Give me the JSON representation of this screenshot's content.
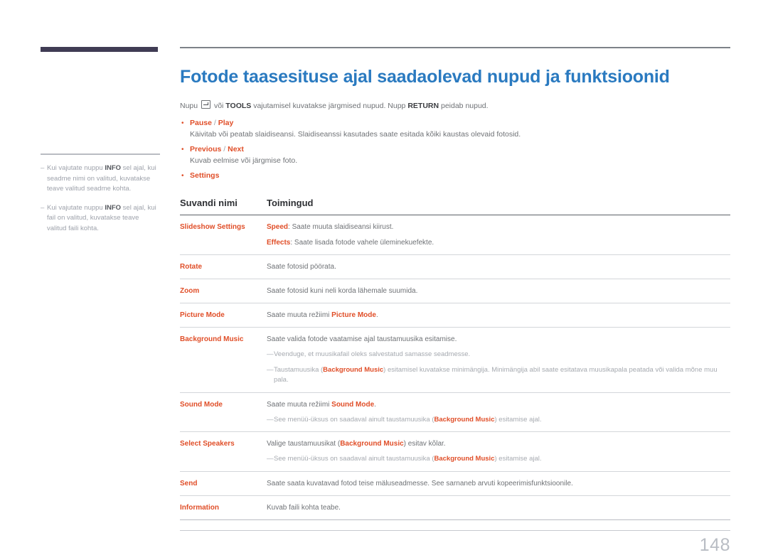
{
  "sidebar": {
    "notes": [
      {
        "dash": "–",
        "pre": "Kui vajutate nuppu ",
        "bold": "INFO",
        "post": " sel ajal, kui seadme nimi on valitud, kuvatakse teave valitud seadme kohta."
      },
      {
        "dash": "–",
        "pre": "Kui vajutate nuppu ",
        "bold": "INFO",
        "post": " sel ajal, kui fail on valitud, kuvatakse teave valitud faili kohta."
      }
    ]
  },
  "content": {
    "title": "Fotode taasesituse ajal saadaolevad nupud ja funktsioonid",
    "intro": {
      "p1": "Nupu ",
      "icon": "enter-key-icon",
      "p2": " või ",
      "b1": "TOOLS",
      "p3": " vajutamisel kuvatakse järgmised nupud. Nupp ",
      "b2": "RETURN",
      "p4": " peidab nupud."
    },
    "bullets": [
      {
        "dot": "•",
        "title_a": "Pause",
        "sep": " / ",
        "title_b": "Play",
        "desc": "Käivitab või peatab slaidiseansi. Slaidiseanssi kasutades saate esitada kõiki kaustas olevaid fotosid."
      },
      {
        "dot": "•",
        "title_a": "Previous",
        "sep": " / ",
        "title_b": "Next",
        "desc": "Kuvab eelmise või järgmise foto."
      },
      {
        "dot": "•",
        "title_a": "Settings",
        "sep": "",
        "title_b": "",
        "desc": ""
      }
    ],
    "table": {
      "headers": {
        "col1": "Suvandi nimi",
        "col2": "Toimingud"
      },
      "rows": [
        {
          "name": "Slideshow Settings",
          "lines": [
            {
              "hl": "Speed",
              "text": ": Saate muuta slaidiseansi kiirust."
            },
            {
              "hl": "Effects",
              "text": ": Saate lisada fotode vahele üleminekuefekte."
            }
          ],
          "subs": []
        },
        {
          "name": "Rotate",
          "lines": [
            {
              "hl": "",
              "text": "Saate fotosid pöörata."
            }
          ],
          "subs": []
        },
        {
          "name": "Zoom",
          "lines": [
            {
              "hl": "",
              "text": "Saate fotosid kuni neli korda lähemale suumida."
            }
          ],
          "subs": []
        },
        {
          "name": "Picture Mode",
          "lines": [
            {
              "hl": "",
              "text": "Saate muuta režiimi ",
              "hl_after": "Picture Mode",
              "tail": "."
            }
          ],
          "subs": []
        },
        {
          "name": "Background Music",
          "lines": [
            {
              "hl": "",
              "text": "Saate valida fotode vaatamise ajal taustamuusika esitamise."
            }
          ],
          "subs": [
            {
              "dash": "—",
              "pre": "Veenduge, et muusikafail oleks salvestatud samasse seadmesse.",
              "hl": "",
              "post": ""
            },
            {
              "dash": "—",
              "pre": "Taustamuusika (",
              "hl": "Background Music",
              "post": ") esitamisel kuvatakse minimängija. Minimängija abil saate esitatava muusikapala peatada või valida mõne muu pala."
            }
          ]
        },
        {
          "name": "Sound Mode",
          "lines": [
            {
              "hl": "",
              "text": "Saate muuta režiimi ",
              "hl_after": "Sound Mode",
              "tail": "."
            }
          ],
          "subs": [
            {
              "dash": "—",
              "pre": "See menüü-üksus on saadaval ainult taustamuusika (",
              "hl": "Background Music",
              "post": ") esitamise ajal."
            }
          ]
        },
        {
          "name": "Select Speakers",
          "lines": [
            {
              "hl": "",
              "text": "Valige taustamuusikat (",
              "hl_after": "Background Music",
              "tail": ") esitav kõlar."
            }
          ],
          "subs": [
            {
              "dash": "—",
              "pre": "See menüü-üksus on saadaval ainult taustamuusika (",
              "hl": "Background Music",
              "post": ") esitamise ajal."
            }
          ]
        },
        {
          "name": "Send",
          "lines": [
            {
              "hl": "",
              "text": "Saate saata kuvatavad fotod teise mäluseadmesse. See sarnaneb arvuti kopeerimisfunktsioonile."
            }
          ],
          "subs": []
        },
        {
          "name": "Information",
          "lines": [
            {
              "hl": "",
              "text": "Kuvab faili kohta teabe."
            }
          ],
          "subs": []
        }
      ]
    },
    "page_number": "148"
  },
  "colors": {
    "heading_blue": "#2a7ac0",
    "accent_orange": "#e04e28",
    "body_gray": "#6f7276",
    "sidebar_bar": "#403c54",
    "page_number_gray": "#b9bdc4"
  }
}
